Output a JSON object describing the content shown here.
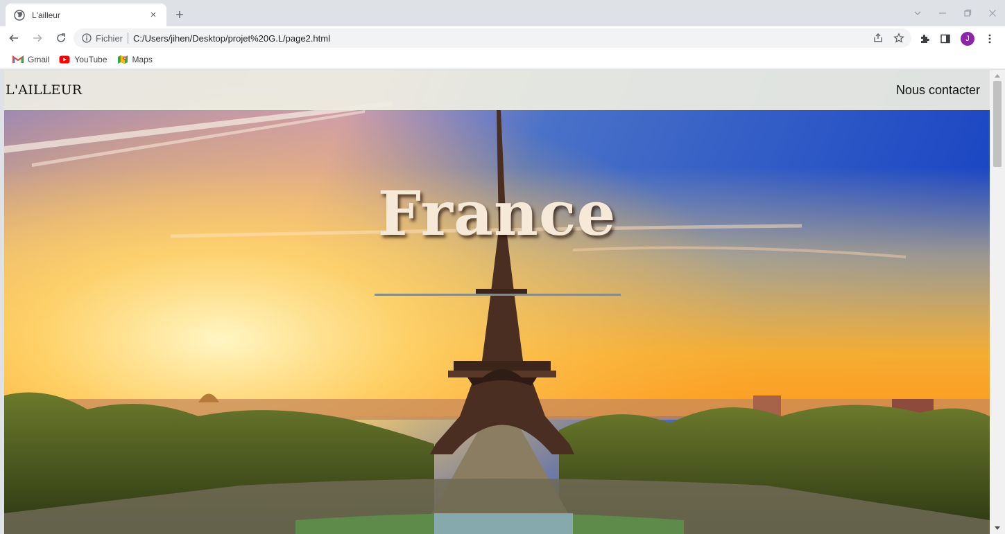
{
  "browser": {
    "tab_title": "L'ailleur",
    "tab_close": "×",
    "new_tab": "+",
    "address_scheme": "Fichier",
    "address_url": "C:/Users/jihen/Desktop/projet%20G.L/page2.html",
    "profile_initial": "J",
    "profile_color": "#8e24aa",
    "bookmarks": [
      {
        "label": "Gmail",
        "icon": "gmail-icon"
      },
      {
        "label": "YouTube",
        "icon": "youtube-icon"
      },
      {
        "label": "Maps",
        "icon": "maps-icon"
      }
    ]
  },
  "site": {
    "logo": "L'AILLEUR",
    "contact_link": "Nous contacter",
    "hero_title": "France",
    "hero_image": "eiffel-tower-sunset"
  }
}
